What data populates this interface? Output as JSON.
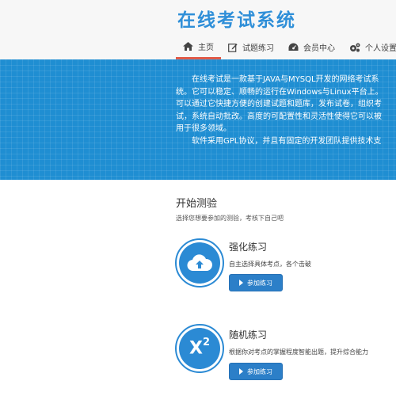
{
  "header": {
    "logo": "在线考试系统",
    "nav": [
      {
        "label": "主页",
        "icon": "home-icon",
        "active": true
      },
      {
        "label": "试题练习",
        "icon": "edit-icon",
        "active": false
      },
      {
        "label": "会员中心",
        "icon": "dashboard-icon",
        "active": false
      },
      {
        "label": "个人设置",
        "icon": "cogs-icon",
        "active": false
      }
    ]
  },
  "hero": {
    "lines": [
      "在线考试是一款基于JAVA与MYSQL开发的网络考试系",
      "统。它可以稳定、顺畅的运行在Windows与Linux平台上。",
      "可以通过它快捷方便的创建试题和题库，发布试卷，组织考",
      "试，系统自动批改。高度的可配置性和灵活性使得它可以被",
      "用于很多领域。",
      "软件采用GPL协议，并且有固定的开发团队提供技术支"
    ]
  },
  "test_section": {
    "title": "开始测验",
    "subtitle": "选择您想要参加的测验，考核下自己吧",
    "cards": [
      {
        "title": "强化练习",
        "desc": "自主选择具体考点，各个击破",
        "button": "参加练习",
        "icon": "cloud-upload-icon"
      },
      {
        "title": "随机练习",
        "desc": "根据你对考点的掌握程度智能出题，提升综合能力",
        "button": "参加练习",
        "icon": "superscript-icon",
        "icon_text": "X",
        "icon_sup": "2"
      }
    ]
  },
  "colors": {
    "brand_blue": "#2f8fd8",
    "hero_bg": "#1f8ed2",
    "button_bg": "#2c7fc8",
    "nav_active": "#e05a48"
  }
}
